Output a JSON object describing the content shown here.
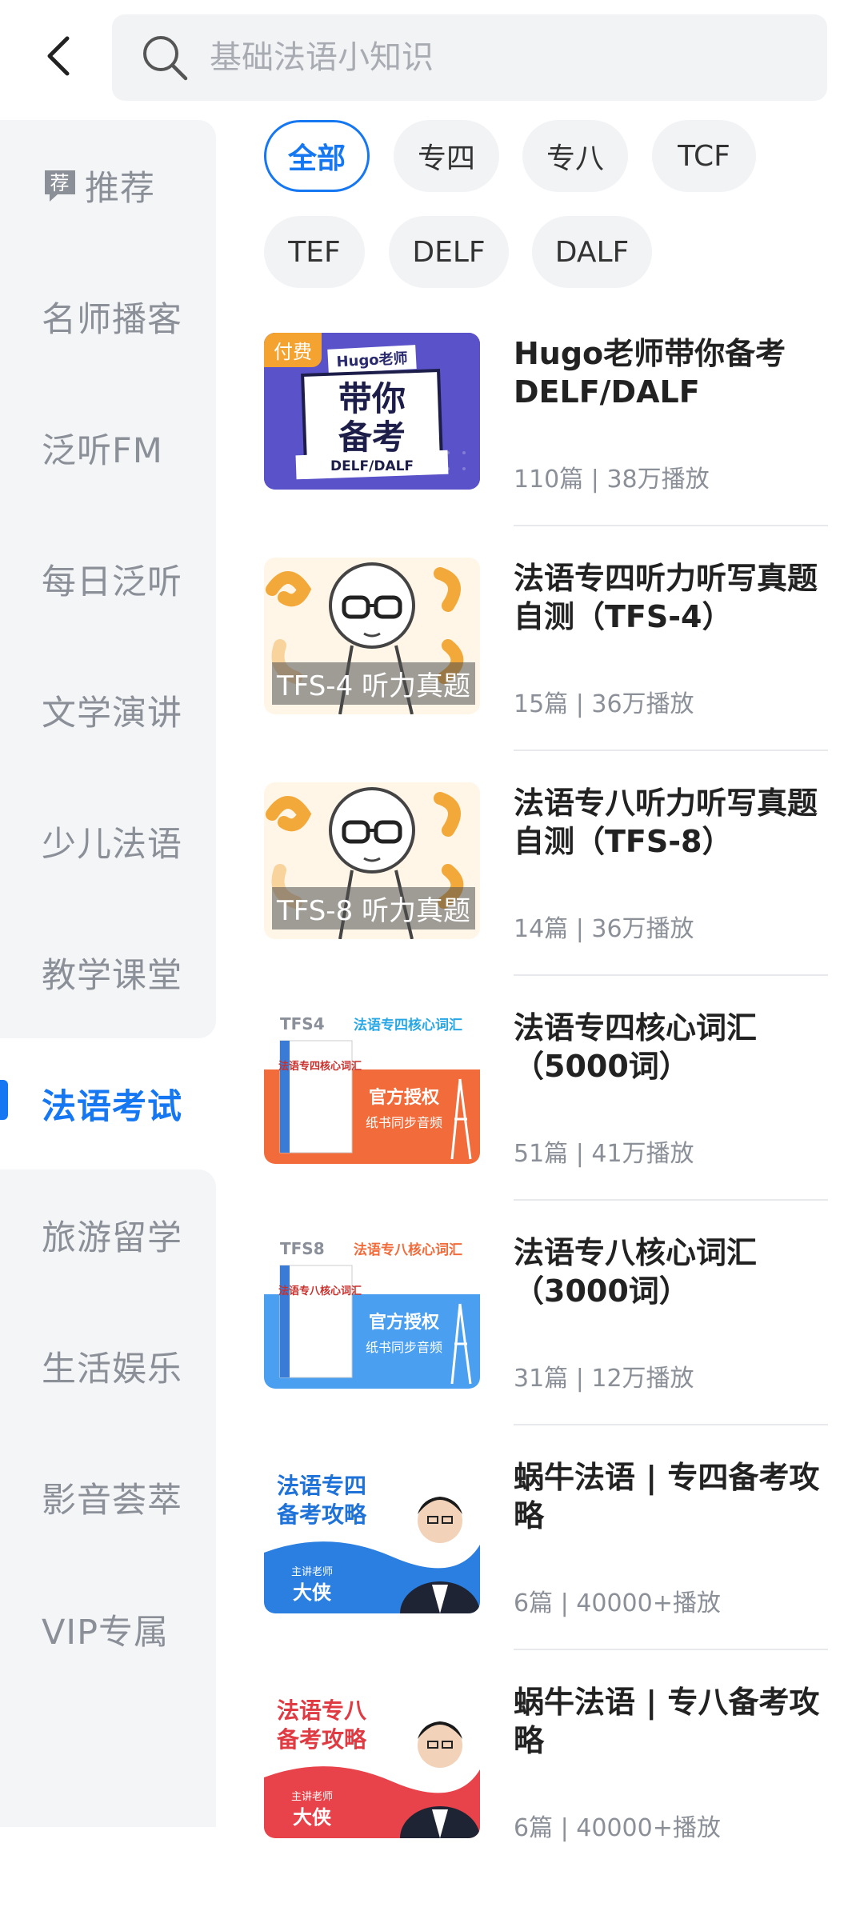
{
  "search": {
    "placeholder": "基础法语小知识"
  },
  "sidebar": {
    "items": [
      {
        "label": "推荐",
        "badge": "荐"
      },
      {
        "label": "名师播客"
      },
      {
        "label": "泛听FM"
      },
      {
        "label": "每日泛听"
      },
      {
        "label": "文学演讲"
      },
      {
        "label": "少儿法语"
      },
      {
        "label": "教学课堂"
      },
      {
        "label": "法语考试",
        "active": true
      },
      {
        "label": "旅游留学"
      },
      {
        "label": "生活娱乐"
      },
      {
        "label": "影音荟萃"
      },
      {
        "label": "VIP专属"
      }
    ]
  },
  "filters": {
    "chips": [
      "全部",
      "专四",
      "专八",
      "TCF",
      "TEF",
      "DELF",
      "DALF"
    ],
    "selected": "全部"
  },
  "courses": [
    {
      "title": "Hugo老师带你备考DELF/DALF",
      "meta": "110篇 | 38万播放",
      "thumb": {
        "tag": "付费",
        "line1": "Hugo老师",
        "line2": "带你",
        "line3": "备考",
        "line4": "DELF/DALF"
      }
    },
    {
      "title": "法语专四听力听写真题自测（TFS-4）",
      "meta": "15篇 | 36万播放",
      "thumb": {
        "label": "TFS-4 听力真题"
      }
    },
    {
      "title": "法语专八听力听写真题自测（TFS-8）",
      "meta": "14篇 | 36万播放",
      "thumb": {
        "label": "TFS-8 听力真题"
      }
    },
    {
      "title": "法语专四核心词汇（5000词）",
      "meta": "51篇 | 41万播放",
      "thumb": {
        "code": "TFS4",
        "heading": "法语专四核心词汇",
        "book": "法语专四核心词汇",
        "line1": "官方授权",
        "line2": "纸书同步音频"
      }
    },
    {
      "title": "法语专八核心词汇（3000词）",
      "meta": "31篇 | 12万播放",
      "thumb": {
        "code": "TFS8",
        "heading": "法语专八核心词汇",
        "book": "法语专八核心词汇",
        "line1": "官方授权",
        "line2": "纸书同步音频"
      }
    },
    {
      "title": "蜗牛法语 | 专四备考攻略",
      "meta": "6篇 | 40000+播放",
      "thumb": {
        "line1": "法语专四",
        "line2": "备考攻略",
        "small": "主讲老师",
        "name": "大侠"
      }
    },
    {
      "title": "蜗牛法语 | 专八备考攻略",
      "meta": "6篇 | 40000+播放",
      "thumb": {
        "line1": "法语专八",
        "line2": "备考攻略",
        "small": "主讲老师",
        "name": "大侠"
      }
    }
  ],
  "colors": {
    "accent": "#1677f2",
    "sidebar_bg": "#f4f5f7",
    "chip_bg": "#f2f3f5"
  }
}
